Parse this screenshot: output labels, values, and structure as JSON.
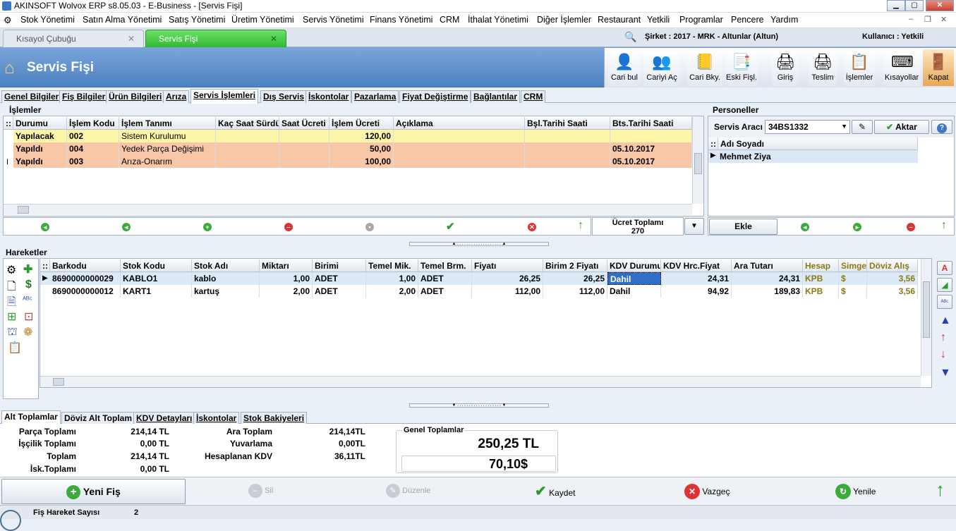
{
  "window": {
    "title": "AKINSOFT Wolvox ERP s8.05.03 - E-Business - [Servis Fişi]"
  },
  "menu": [
    "Stok Yönetimi",
    "Satın Alma Yönetimi",
    "Satış Yönetimi",
    "Üretim Yönetimi",
    "Servis Yönetimi",
    "Finans Yönetimi",
    "CRM",
    "İthalat Yönetimi",
    "Diğer İşlemler",
    "Restaurant",
    "Yetkili",
    "Programlar",
    "Pencere",
    "Yardım"
  ],
  "doc_tabs": [
    {
      "label": "Kısayol Çubuğu"
    },
    {
      "label": "Servis Fişi"
    }
  ],
  "company": "Şirket : 2017 - MRK - Altunlar (Altun)",
  "user": "Kullanıcı : Yetkili",
  "banner_title": "Servis Fişi",
  "toolbar": [
    "Cari bul",
    "Cariyi Aç",
    "Cari Bky.",
    "Eski Fişl.",
    "Giriş",
    "Teslim",
    "İşlemler",
    "Kısayollar",
    "Kapat"
  ],
  "form_tabs": [
    "Genel Bilgiler",
    "Fiş Bilgileri",
    "Ürün Bilgileri",
    "Arıza",
    "Servis İşlemleri",
    "Dış Servis",
    "İskontolar",
    "Pazarlama",
    "Fiyat Değiştirme",
    "Bağlantılar",
    "CRM"
  ],
  "islemler": {
    "title": "İşlemler",
    "columns": [
      "Durumu",
      "İşlem Kodu",
      "İşlem Tanımı",
      "Kaç Saat Sürdü",
      "Saat Ücreti",
      "İşlem Ücreti",
      "Açıklama",
      "Bşl.Tarihi Saati",
      "Bts.Tarihi Saati"
    ],
    "rows": [
      {
        "durum": "Yapılacak",
        "kod": "002",
        "tanim": "Sistem Kurulumu",
        "saat": "",
        "saat_ucreti": "",
        "ucret": "120,00",
        "aciklama": "",
        "bsl": "",
        "bts": ""
      },
      {
        "durum": "Yapıldı",
        "kod": "004",
        "tanim": "Yedek Parça Değişimi",
        "saat": "",
        "saat_ucreti": "",
        "ucret": "50,00",
        "aciklama": "",
        "bsl": "",
        "bts": "05.10.2017"
      },
      {
        "durum": "Yapıldı",
        "kod": "003",
        "tanim": "Arıza-Onarım",
        "saat": "",
        "saat_ucreti": "",
        "ucret": "100,00",
        "aciklama": "",
        "bsl": "",
        "bts": "05.10.2017"
      }
    ],
    "ucret_toplami_label": "Ücret Toplamı",
    "ucret_toplami": "270"
  },
  "personeller": {
    "title": "Personeller",
    "servis_araci_label": "Servis Aracı",
    "servis_araci": "34BS1332",
    "aktar": "Aktar",
    "column": "Adı Soyadı",
    "rows": [
      "Mehmet  Ziya"
    ],
    "ekle": "Ekle"
  },
  "hareketler": {
    "title": "Hareketler",
    "columns": [
      "Barkodu",
      "Stok Kodu",
      "Stok Adı",
      "Miktarı",
      "Birimi",
      "Temel Mik.",
      "Temel Brm.",
      "Fiyatı",
      "Birim 2 Fiyatı",
      "KDV Durumu",
      "KDV Hrc.Fiyat",
      "Ara Tutarı",
      "Hesap",
      "Simge",
      "Döviz Alış"
    ],
    "rows": [
      [
        "8690000000029",
        "KABLO1",
        "kablo",
        "1,00",
        "ADET",
        "1,00",
        "ADET",
        "26,25",
        "26,25",
        "Dahil",
        "24,31",
        "24,31",
        "KPB",
        "$",
        "3,56"
      ],
      [
        "8690000000012",
        "KART1",
        "kartuş",
        "2,00",
        "ADET",
        "2,00",
        "ADET",
        "112,00",
        "112,00",
        "Dahil",
        "94,92",
        "189,83",
        "KPB",
        "$",
        "3,56"
      ]
    ]
  },
  "bottom_tabs": [
    "Alt Toplamlar",
    "Döviz Alt Toplam",
    "KDV Detayları",
    "İskontolar",
    "Stok Bakiyeleri"
  ],
  "totals": {
    "parca_label": "Parça Toplamı",
    "parca": "214,14 TL",
    "iscilik_label": "İşçilik Toplamı",
    "iscilik": "0,00 TL",
    "toplam_label": "Toplam",
    "toplam": "214,14 TL",
    "isk_label": "İsk.Toplamı",
    "isk": "0,00 TL",
    "ara_label": "Ara Toplam",
    "ara": "214,14TL",
    "yuv_label": "Yuvarlama",
    "yuv": "0,00TL",
    "kdv_label": "Hesaplanan KDV",
    "kdv": "36,11TL",
    "genel_label": "Genel Toplamlar",
    "genel_tl": "250,25 TL",
    "genel_usd": "70,10$"
  },
  "actions": {
    "yeni": "Yeni Fiş",
    "sil": "Sil",
    "duzenle": "Düzenle",
    "kaydet": "Kaydet",
    "vazgec": "Vazgeç",
    "yenile": "Yenile"
  },
  "status": {
    "label": "Fiş Hareket Sayısı",
    "value": "2"
  }
}
